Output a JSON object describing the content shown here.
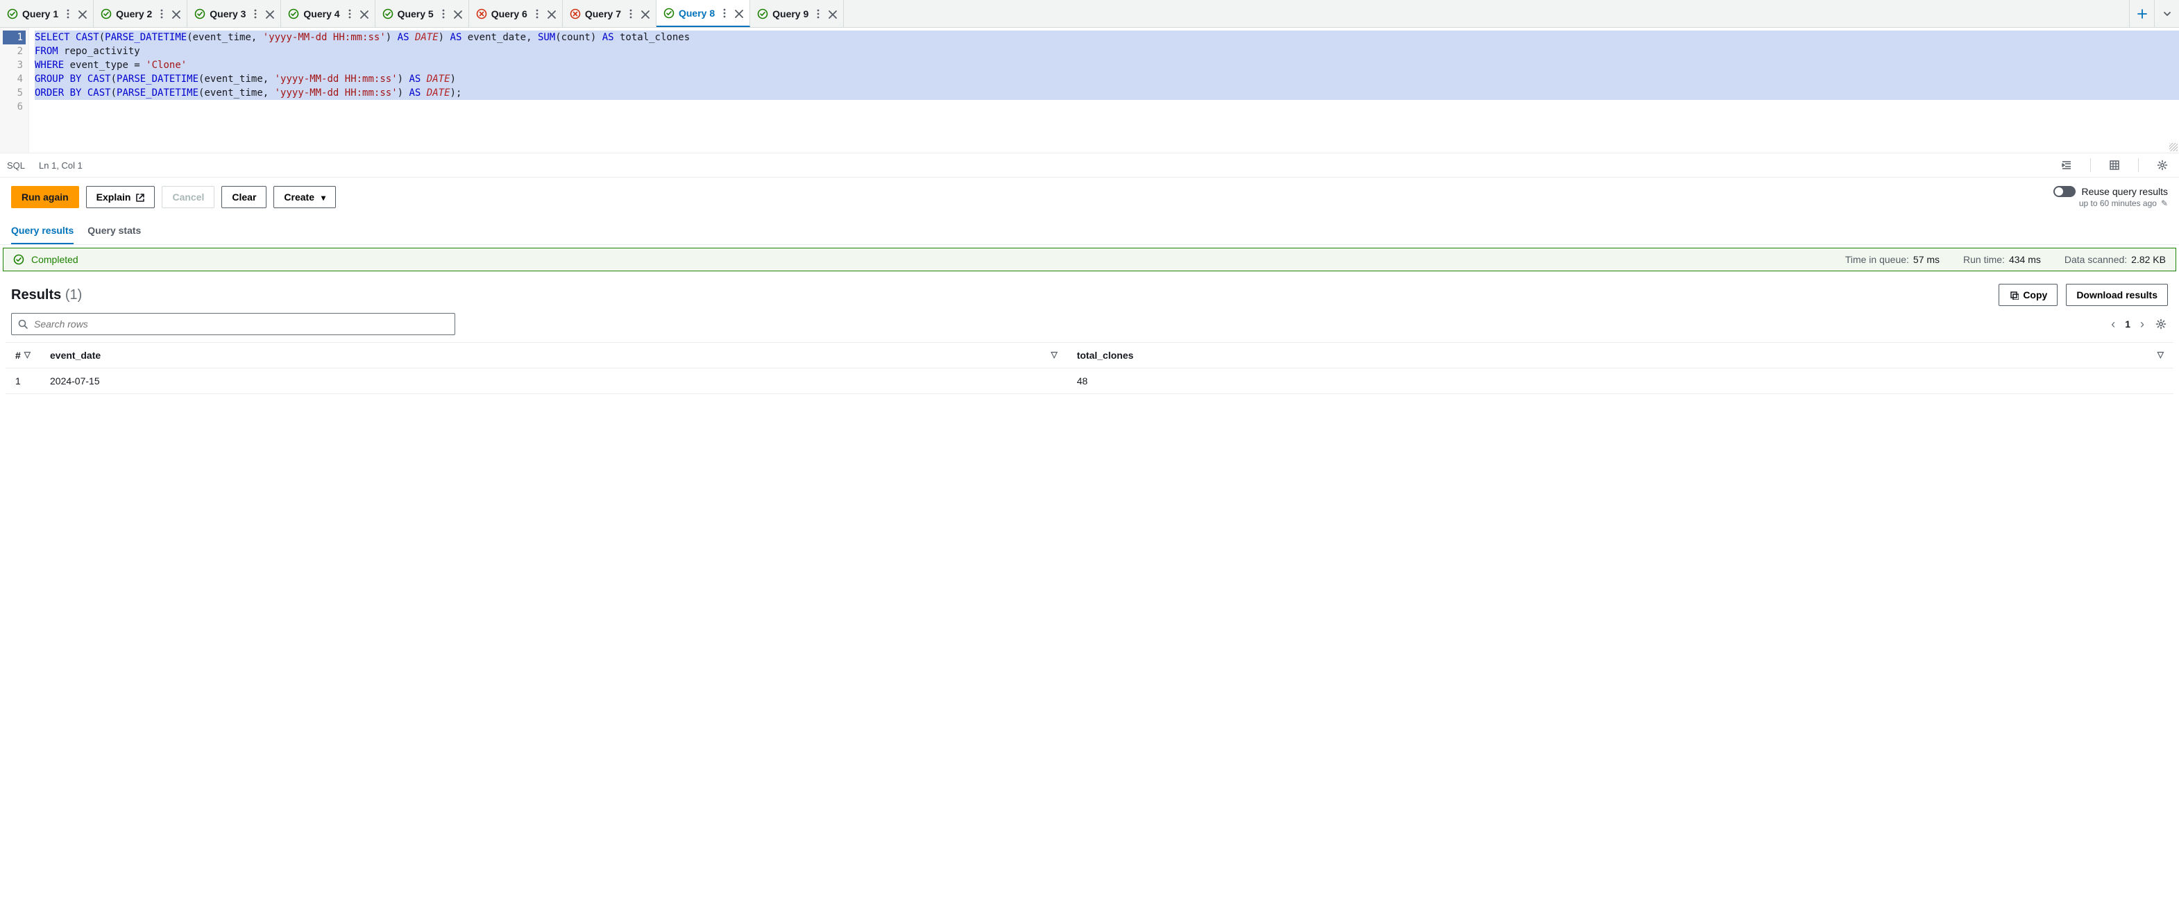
{
  "tabs": [
    {
      "label": "Query 1",
      "status": "ok"
    },
    {
      "label": "Query 2",
      "status": "ok"
    },
    {
      "label": "Query 3",
      "status": "ok"
    },
    {
      "label": "Query 4",
      "status": "ok"
    },
    {
      "label": "Query 5",
      "status": "ok"
    },
    {
      "label": "Query 6",
      "status": "err"
    },
    {
      "label": "Query 7",
      "status": "err"
    },
    {
      "label": "Query 8",
      "status": "ok",
      "active": true
    },
    {
      "label": "Query 9",
      "status": "ok"
    }
  ],
  "editor": {
    "language": "SQL",
    "cursor": "Ln 1, Col 1",
    "lines": [
      {
        "n": 1,
        "sel": true,
        "tokens": [
          [
            "kw",
            "SELECT"
          ],
          [
            "",
            " "
          ],
          [
            "fn",
            "CAST"
          ],
          [
            "",
            "("
          ],
          [
            "fn",
            "PARSE_DATETIME"
          ],
          [
            "",
            "(event_time, "
          ],
          [
            "str",
            "'yyyy-MM-dd HH:mm:ss'"
          ],
          [
            "",
            ") "
          ],
          [
            "kw",
            "AS"
          ],
          [
            "",
            " "
          ],
          [
            "typ",
            "DATE"
          ],
          [
            "",
            ") "
          ],
          [
            "kw",
            "AS"
          ],
          [
            "",
            " event_date, "
          ],
          [
            "fn",
            "SUM"
          ],
          [
            "",
            "(count) "
          ],
          [
            "kw",
            "AS"
          ],
          [
            "",
            " total_clones"
          ]
        ]
      },
      {
        "n": 2,
        "sel": true,
        "tokens": [
          [
            "kw",
            "FROM"
          ],
          [
            "",
            " repo_activity"
          ]
        ]
      },
      {
        "n": 3,
        "sel": true,
        "tokens": [
          [
            "kw",
            "WHERE"
          ],
          [
            "",
            " event_type = "
          ],
          [
            "str",
            "'Clone'"
          ]
        ]
      },
      {
        "n": 4,
        "sel": true,
        "tokens": [
          [
            "kw",
            "GROUP BY"
          ],
          [
            "",
            " "
          ],
          [
            "fn",
            "CAST"
          ],
          [
            "",
            "("
          ],
          [
            "fn",
            "PARSE_DATETIME"
          ],
          [
            "",
            "(event_time, "
          ],
          [
            "str",
            "'yyyy-MM-dd HH:mm:ss'"
          ],
          [
            "",
            ") "
          ],
          [
            "kw",
            "AS"
          ],
          [
            "",
            " "
          ],
          [
            "typ",
            "DATE"
          ],
          [
            "",
            ")"
          ]
        ]
      },
      {
        "n": 5,
        "sel": true,
        "tokens": [
          [
            "kw",
            "ORDER BY"
          ],
          [
            "",
            " "
          ],
          [
            "fn",
            "CAST"
          ],
          [
            "",
            "("
          ],
          [
            "fn",
            "PARSE_DATETIME"
          ],
          [
            "",
            "(event_time, "
          ],
          [
            "str",
            "'yyyy-MM-dd HH:mm:ss'"
          ],
          [
            "",
            ") "
          ],
          [
            "kw",
            "AS"
          ],
          [
            "",
            " "
          ],
          [
            "typ",
            "DATE"
          ],
          [
            "",
            ");"
          ]
        ]
      },
      {
        "n": 6,
        "sel": false,
        "tokens": [
          [
            "",
            ""
          ]
        ]
      }
    ]
  },
  "actions": {
    "run": "Run again",
    "explain": "Explain",
    "cancel": "Cancel",
    "clear": "Clear",
    "create": "Create"
  },
  "reuse": {
    "label": "Reuse query results",
    "sub": "up to 60 minutes ago"
  },
  "result_tabs": {
    "results": "Query results",
    "stats": "Query stats"
  },
  "banner": {
    "status": "Completed",
    "queue_label": "Time in queue:",
    "queue_value": "57 ms",
    "run_label": "Run time:",
    "run_value": "434 ms",
    "scan_label": "Data scanned:",
    "scan_value": "2.82 KB"
  },
  "results": {
    "title": "Results",
    "count": "(1)",
    "copy": "Copy",
    "download": "Download results",
    "search_placeholder": "Search rows",
    "page": "1",
    "columns": [
      "#",
      "event_date",
      "total_clones"
    ],
    "rows": [
      {
        "idx": "1",
        "event_date": "2024-07-15",
        "total_clones": "48"
      }
    ]
  }
}
